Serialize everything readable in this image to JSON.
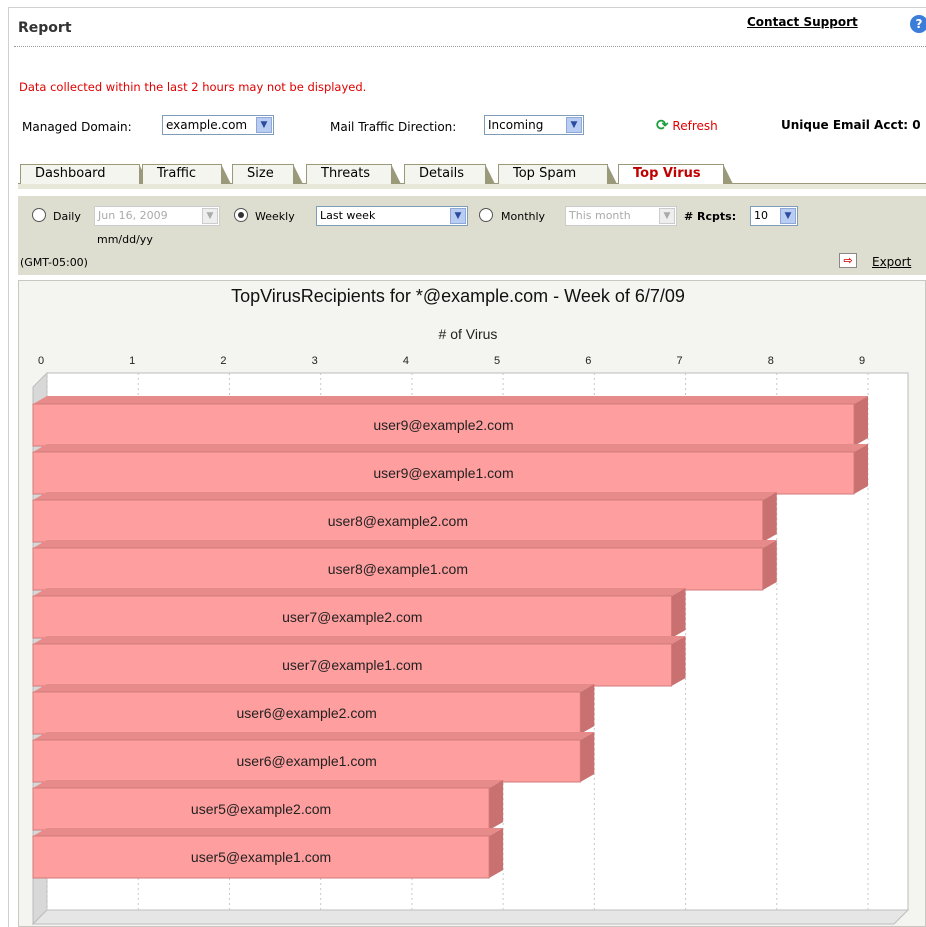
{
  "header": {
    "title": "Report",
    "contact_support": "Contact Support",
    "help_icon": "?"
  },
  "notice": "Data collected within the last 2 hours may not be displayed.",
  "filters": {
    "managed_domain_label": "Managed Domain:",
    "managed_domain_value": "example.com",
    "direction_label": "Mail Traffic Direction:",
    "direction_value": "Incoming",
    "refresh_label": "Refresh",
    "unique_label": "Unique Email Acct: 0"
  },
  "tabs": [
    "Dashboard",
    "Traffic",
    "Size",
    "Threats",
    "Details",
    "Top Spam",
    "Top Virus"
  ],
  "active_tab": "Top Virus",
  "options": {
    "daily_label": "Daily",
    "daily_value": "Jun 16, 2009",
    "date_format": "mm/dd/yy",
    "weekly_label": "Weekly",
    "weekly_value": "Last week",
    "monthly_label": "Monthly",
    "monthly_value": "This month",
    "rcpts_label": "# Rcpts:",
    "rcpts_value": "10",
    "timezone": "(GMT-05:00)",
    "export_label": "Export",
    "selected_period": "weekly"
  },
  "chart_data": {
    "type": "bar",
    "orientation": "horizontal",
    "title": "TopVirusRecipients for *@example.com - Week of 6/7/09",
    "xlabel": "# of Virus",
    "xlim": [
      0,
      9
    ],
    "ticks": [
      "0",
      "1",
      "2",
      "3",
      "4",
      "5",
      "6",
      "7",
      "8",
      "9"
    ],
    "categories": [
      "user9@example2.com",
      "user9@example1.com",
      "user8@example2.com",
      "user8@example1.com",
      "user7@example2.com",
      "user7@example1.com",
      "user6@example2.com",
      "user6@example1.com",
      "user5@example2.com",
      "user5@example1.com"
    ],
    "values": [
      9,
      9,
      8,
      8,
      7,
      7,
      6,
      6,
      5,
      5
    ],
    "bar_color": "#ff9e9e",
    "grid": true
  }
}
